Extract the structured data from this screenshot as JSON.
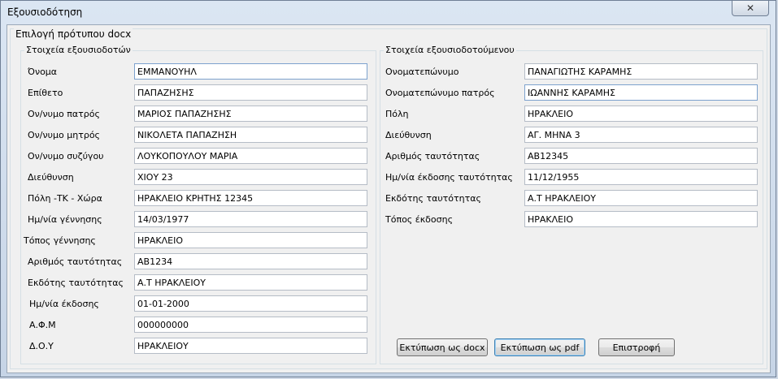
{
  "window": {
    "title": "Εξουσιοδότηση",
    "close_symbol": "✕"
  },
  "template_group": {
    "label": "Επιλογή πρότυπου docx"
  },
  "grantor": {
    "label": "Στοιχεία εξουσιοδοτών",
    "fields": [
      {
        "label": "Όνομα",
        "value": "ΕΜΜΑΝΟΥΗΛ"
      },
      {
        "label": "Επίθετο",
        "value": "ΠΑΠΑΖΗΣΗΣ"
      },
      {
        "label": "Ον/νυμο πατρός",
        "value": "ΜΑΡΙΟΣ ΠΑΠΑΖΗΣΗΣ"
      },
      {
        "label": "Ον/νυμο μητρός",
        "value": "ΝΙΚΟΛΕΤΑ ΠΑΠΑΖΗΣΗ"
      },
      {
        "label": "Ον/νυμο συζύγου",
        "value": "ΛΟΥΚΟΠΟΥΛΟΥ ΜΑΡΙΑ"
      },
      {
        "label": "Διεύθυνση",
        "value": "ΧΙΟΥ 23"
      },
      {
        "label": "Πόλη -ΤΚ - Χώρα",
        "value": "ΗΡΑΚΛΕΙΟ ΚΡΗΤΗΣ 12345"
      },
      {
        "label": "Ημ/νία γέννησης",
        "value": "14/03/1977"
      },
      {
        "label": "Τόπος γέννησης",
        "value": "ΗΡΑΚΛΕΙΟ"
      },
      {
        "label": "Αριθμός ταυτότητας",
        "value": "ΑΒ1234"
      },
      {
        "label": "Εκδότης ταυτότητας",
        "value": "Α.Τ ΗΡΑΚΛΕΙΟΥ"
      },
      {
        "label": "Ημ/νία έκδοσης",
        "value": "01-01-2000"
      },
      {
        "label": "Α.Φ.Μ",
        "value": "000000000"
      },
      {
        "label": "Δ.Ο.Υ",
        "value": "ΗΡΑΚΛΕΙΟΥ"
      }
    ]
  },
  "grantee": {
    "label": "Στοιχεία εξουσιοδοτούμενου",
    "fields": [
      {
        "label": "Ονοματεπώνυμο",
        "value": "ΠΑΝΑΓΙΩΤΗΣ ΚΑΡΑΜΗΣ"
      },
      {
        "label": "Ονοματεπώνυμο πατρός",
        "value": "ΙΩΑΝΝΗΣ ΚΑΡΑΜΗΣ"
      },
      {
        "label": "Πόλη",
        "value": "ΗΡΑΚΛΕΙΟ"
      },
      {
        "label": "Διεύθυνση",
        "value": "ΑΓ. ΜΗΝΑ 3"
      },
      {
        "label": "Αριθμός ταυτότητας",
        "value": "ΑΒ12345"
      },
      {
        "label": "Ημ/νία έκδοσης ταυτότητας",
        "value": "11/12/1955"
      },
      {
        "label": "Εκδότης ταυτότητας",
        "value": "Α.Τ ΗΡΑΚΛΕΙΟΥ"
      },
      {
        "label": "Τόπος έκδοσης",
        "value": "ΗΡΑΚΛΕΙΟ"
      }
    ]
  },
  "buttons": {
    "print_docx": "Εκτύπωση ως docx",
    "print_pdf": "Εκτύπωση ως pdf",
    "back": "Επιστροφή"
  }
}
